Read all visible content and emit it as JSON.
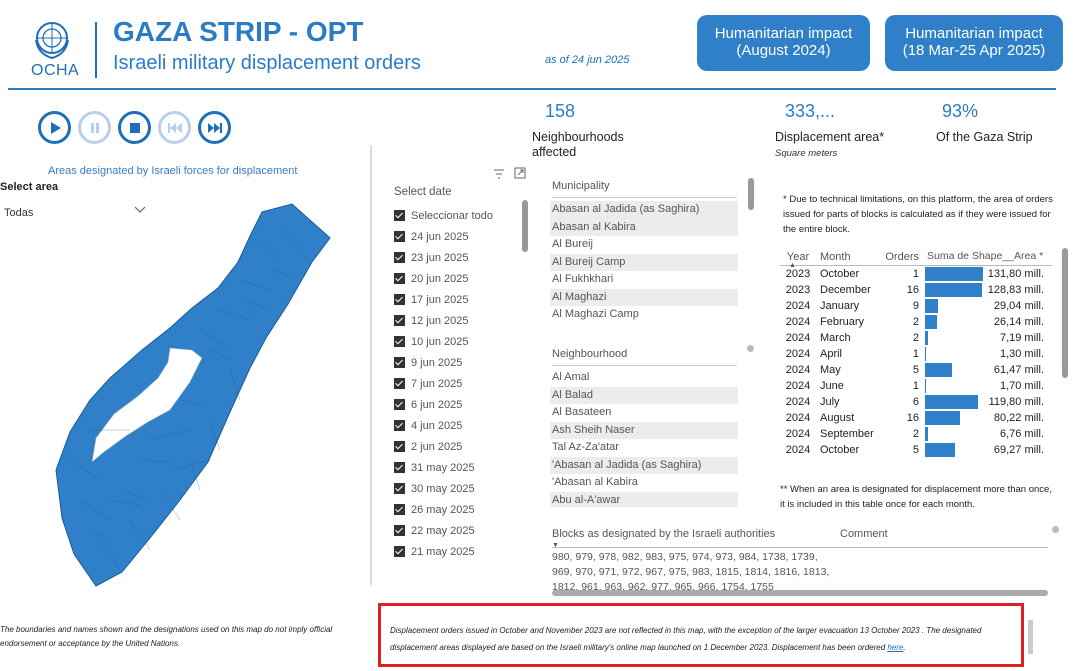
{
  "header": {
    "logo_text": "OCHA",
    "title": "GAZA STRIP - OPT",
    "subtitle": "Israeli military displacement orders",
    "as_of": "as of 24 jun 2025",
    "buttons": [
      {
        "line1": "Humanitarian impact",
        "line2": "(August 2024)"
      },
      {
        "line1": "Humanitarian impact",
        "line2": "(18 Mar-25 Apr 2025)"
      }
    ]
  },
  "player": {
    "controls": [
      "play-icon",
      "pause-icon",
      "stop-icon",
      "skip-back-icon",
      "skip-forward-icon"
    ]
  },
  "map_panel": {
    "title": "Areas designated by Israeli forces for displacement",
    "select_label": "Select area",
    "select_value": "Todas",
    "disclaimer": "The boundaries and names shown and the designations used on this map do not imply official endorsement or acceptance by the United Nations."
  },
  "dates": {
    "title": "Select date",
    "items": [
      "Seleccionar todo",
      "24 jun 2025",
      "23 jun 2025",
      "20 jun 2025",
      "17 jun 2025",
      "12 jun 2025",
      "10 jun 2025",
      "9 jun 2025",
      "7 jun 2025",
      "6 jun 2025",
      "4 jun 2025",
      "2 jun 2025",
      "31 may 2025",
      "30 may 2025",
      "26 may 2025",
      "22 may 2025",
      "21 may 2025"
    ]
  },
  "kpis": [
    {
      "value": "158",
      "label1": "Neighbourhoods",
      "label2": "affected",
      "sub": ""
    },
    {
      "value": "333,...",
      "label1": "Displacement area*",
      "label2": "",
      "sub": "Square meters"
    },
    {
      "value": "93%",
      "label1": "Of the Gaza Strip",
      "label2": "",
      "sub": ""
    }
  ],
  "municipality": {
    "header": "Municipality",
    "items": [
      "Abasan al Jadida (as Saghira)",
      "Abasan al Kabira",
      "Al Bureij",
      "Al Bureij Camp",
      "Al Fukhkhari",
      "Al Maghazi",
      "Al Maghazi Camp"
    ]
  },
  "neighbourhood": {
    "header": "Neighbourhood",
    "items": [
      "Al Amal",
      "Al Balad",
      "Al Basateen",
      "Ash Sheih Naser",
      "Tal Az-Za'atar",
      "'Abasan al Jadida (as Saghira)",
      "'Abasan al Kabira",
      "Abu al-A'awar"
    ]
  },
  "table": {
    "note_top": "* Due to technical limitations, on this platform, the area of orders issued for parts of blocks is calculated as if they were issued for the entire block.",
    "headers": [
      "Year",
      "Month",
      "Orders",
      "Suma de Shape__Area *"
    ],
    "rows": [
      {
        "year": "2023",
        "month": "October",
        "orders": "1",
        "area": "131,80 mill.",
        "v": 131.8
      },
      {
        "year": "2023",
        "month": "December",
        "orders": "16",
        "area": "128,83 mill.",
        "v": 128.83
      },
      {
        "year": "2024",
        "month": "January",
        "orders": "9",
        "area": "29,04 mill.",
        "v": 29.04
      },
      {
        "year": "2024",
        "month": "February",
        "orders": "2",
        "area": "26,14 mill.",
        "v": 26.14
      },
      {
        "year": "2024",
        "month": "March",
        "orders": "2",
        "area": "7,19 mill.",
        "v": 7.19
      },
      {
        "year": "2024",
        "month": "April",
        "orders": "1",
        "area": "1,30 mill.",
        "v": 1.3
      },
      {
        "year": "2024",
        "month": "May",
        "orders": "5",
        "area": "61,47 mill.",
        "v": 61.47
      },
      {
        "year": "2024",
        "month": "June",
        "orders": "1",
        "area": "1,70 mill.",
        "v": 1.7
      },
      {
        "year": "2024",
        "month": "July",
        "orders": "6",
        "area": "119,80 mill.",
        "v": 119.8
      },
      {
        "year": "2024",
        "month": "August",
        "orders": "16",
        "area": "80,22 mill.",
        "v": 80.22
      },
      {
        "year": "2024",
        "month": "September",
        "orders": "2",
        "area": "6,76 mill.",
        "v": 6.76
      },
      {
        "year": "2024",
        "month": "October",
        "orders": "5",
        "area": "69,27 mill.",
        "v": 69.27
      }
    ],
    "note_bottom": "** When an area is designated for displacement more than once, it is included in this table once for each month."
  },
  "blocks": {
    "header": "Blocks as designated by the Israeli authorities",
    "comment_header": "Comment",
    "text": "980, 979, 978, 982, 983, 975, 974, 973, 984, 1738, 1739, 969, 970, 971, 972, 967, 975, 983, 1815, 1814, 1816, 1813, 1812, 961, 963, 962, 977, 965, 966, 1754, 1755"
  },
  "footer_note": {
    "text": "Displacement orders issued in October and November 2023 are not reflected in this map, with the exception of the larger evacuation 13 October 2023 . The designated displacement areas displayed are based on the Israeli military's online map launched on 1 December 2023. Displacement has been ordered ",
    "link": "here",
    "end": "."
  },
  "colors": {
    "accent": "#2b7cc6",
    "bar": "#2f80c9",
    "highlight_border": "#e02020",
    "map_fill": "#2f80c9"
  }
}
